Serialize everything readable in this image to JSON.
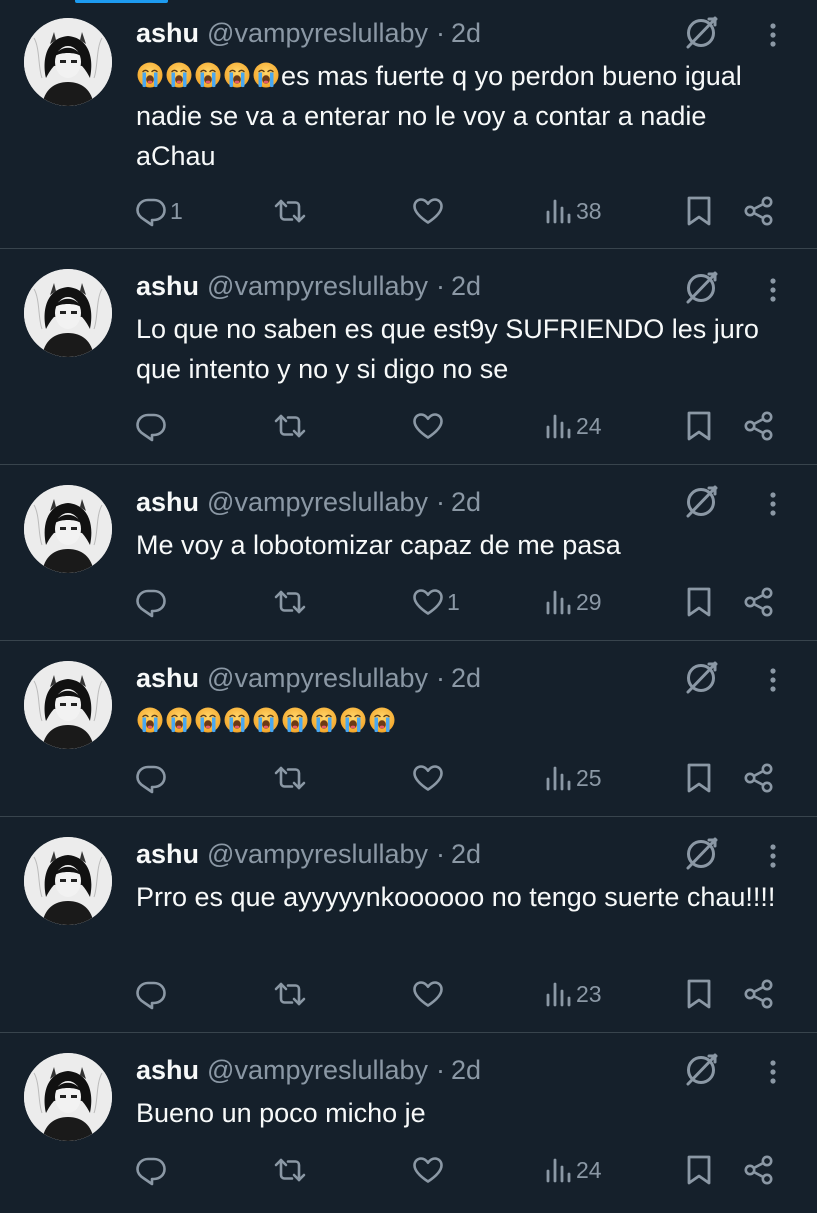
{
  "tweets": [
    {
      "name": "ashu",
      "handle": "@vampyreslullaby",
      "separator": "·",
      "time": "2d",
      "emoji_count": 5,
      "text": "es mas fuerte q yo perdon bueno igual nadie se va a enterar no le voy a contar a nadie aChau",
      "replies": "1",
      "retweets": "",
      "likes": "",
      "views": "38"
    },
    {
      "name": "ashu",
      "handle": "@vampyreslullaby",
      "separator": "·",
      "time": "2d",
      "emoji_count": 0,
      "text": "Lo que no saben es que est9y SUFRIENDO les juro que intento y no y si digo no se",
      "replies": "",
      "retweets": "",
      "likes": "",
      "views": "24"
    },
    {
      "name": "ashu",
      "handle": "@vampyreslullaby",
      "separator": "·",
      "time": "2d",
      "emoji_count": 0,
      "text": "Me voy a lobotomizar capaz de me pasa",
      "replies": "",
      "retweets": "",
      "likes": "1",
      "views": "29"
    },
    {
      "name": "ashu",
      "handle": "@vampyreslullaby",
      "separator": "·",
      "time": "2d",
      "emoji_count": 9,
      "text": "",
      "replies": "",
      "retweets": "",
      "likes": "",
      "views": "25"
    },
    {
      "name": "ashu",
      "handle": "@vampyreslullaby",
      "separator": "·",
      "time": "2d",
      "emoji_count": 0,
      "text": "Prro es que ayyyyynkoooooo no tengo suerte chau!!!!",
      "replies": "",
      "retweets": "",
      "likes": "",
      "views": "23"
    },
    {
      "name": "ashu",
      "handle": "@vampyreslullaby",
      "separator": "·",
      "time": "2d",
      "emoji_count": 0,
      "text": "Bueno un poco micho je",
      "replies": "",
      "retweets": "",
      "likes": "",
      "views": "24"
    }
  ],
  "icons": {
    "emoji": "loudly-crying-face",
    "grok": "grok-icon",
    "more": "more-icon",
    "reply": "reply-icon",
    "retweet": "retweet-icon",
    "like": "like-icon",
    "views": "views-icon",
    "bookmark": "bookmark-icon",
    "share": "share-icon"
  },
  "colors": {
    "background": "#15202b",
    "divider": "#38444d",
    "primary_text": "#f7f9f9",
    "secondary_text": "#8b98a5",
    "accent": "#1d9bf0"
  }
}
